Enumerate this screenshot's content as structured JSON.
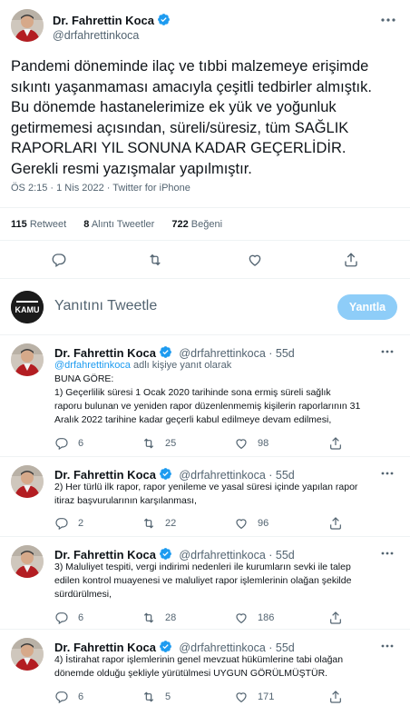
{
  "main_tweet": {
    "author_name": "Dr. Fahrettin Koca",
    "author_handle": "@drfahrettinkoca",
    "verified_icon": "verified-badge-icon",
    "lines": [
      "Pandemi döneminde ilaç ve tıbbi malzemeye erişimde",
      "sıkıntı yaşanmaması amacıyla çeşitli tedbirler almıştık.",
      "Bu dönemde hastanelerimize ek yük ve yoğunluk",
      "getirmemesi açısından, süreli/süresiz, tüm SAĞLIK",
      "RAPORLARI YIL SONUNA KADAR GEÇERLİDİR.",
      "Gerekli resmi yazışmalar yapılmıştır."
    ],
    "meta": "ÖS 2:15 · 1 Nis 2022 · Twitter for iPhone",
    "stats": {
      "retweets_count": "115",
      "retweets_label": "Retweet",
      "quotes_count": "8",
      "quotes_label": "Alıntı Tweetler",
      "likes_count": "722",
      "likes_label": "Beğeni"
    }
  },
  "compose": {
    "avatar_text": "KAMU",
    "placeholder": "Yanıtını Tweetle",
    "button_label": "Yanıtla"
  },
  "replies": [
    {
      "author_name": "Dr. Fahrettin Koca",
      "author_handle": "@drfahrettinkoca · 55d",
      "replying_to_handle": "@drfahrettinkoca",
      "replying_to_suffix": " adlı kişiye yanıt olarak",
      "lines": [
        "BUNA GÖRE:",
        "1) Geçerlilik süresi 1 Ocak 2020 tarihinde sona ermiş süreli sağlık",
        "raporu bulunan ve yeniden rapor düzenlenmemiş kişilerin raporlarının 31",
        "Aralık 2022 tarihine kadar geçerli kabul edilmeye devam edilmesi,"
      ],
      "replies_count": "6",
      "retweets_count": "25",
      "likes_count": "98"
    },
    {
      "author_name": "Dr. Fahrettin Koca",
      "author_handle": "@drfahrettinkoca · 55d",
      "lines": [
        "2) Her türlü ilk rapor, rapor yenileme ve yasal süresi içinde yapılan rapor",
        "itiraz başvurularının karşılanması,"
      ],
      "replies_count": "2",
      "retweets_count": "22",
      "likes_count": "96"
    },
    {
      "author_name": "Dr. Fahrettin Koca",
      "author_handle": "@drfahrettinkoca · 55d",
      "lines": [
        "3) Maluliyet tespiti, vergi indirimi nedenleri ile kurumların sevki ile talep",
        "edilen kontrol muayenesi ve maluliyet rapor işlemlerinin olağan şekilde",
        "sürdürülmesi,"
      ],
      "replies_count": "6",
      "retweets_count": "28",
      "likes_count": "186"
    },
    {
      "author_name": "Dr. Fahrettin Koca",
      "author_handle": "@drfahrettinkoca · 55d",
      "lines": [
        "4) İstirahat rapor işlemlerinin genel mevzuat hükümlerine tabi olağan",
        "dönemde olduğu şekliyle yürütülmesi UYGUN GÖRÜLMÜŞTÜR."
      ],
      "replies_count": "6",
      "retweets_count": "5",
      "likes_count": "171"
    }
  ],
  "colors": {
    "accent": "#1d9bf0",
    "reply_button": "#8ecdf8",
    "secondary_text": "#536471",
    "separator": "#eff3f4"
  }
}
